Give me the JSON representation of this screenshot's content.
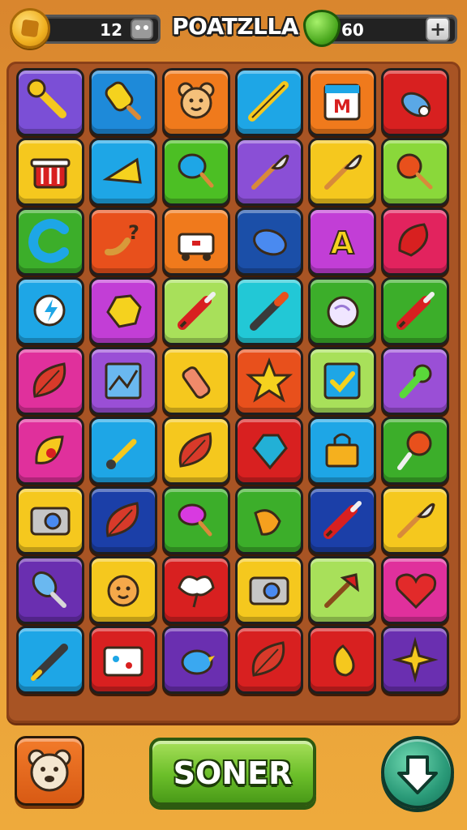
{
  "header": {
    "coins": "12",
    "title": "POATZLLA",
    "energy": "60",
    "coin_icon": "coin-icon",
    "robot_icon": "robot-icon",
    "shield_icon": "green-shield-icon",
    "plus_icon": "plus-icon"
  },
  "board": {
    "rows": 9,
    "cols": 6,
    "tiles": [
      {
        "color": "#7b4fd6",
        "icon": "wrench-icon"
      },
      {
        "color": "#1e8ad9",
        "icon": "ice-pop-icon"
      },
      {
        "color": "#f07a1c",
        "icon": "teddy-bear-icon"
      },
      {
        "color": "#1ea6e6",
        "icon": "ruler-pencil-icon"
      },
      {
        "color": "#f07a1c",
        "icon": "calendar-icon"
      },
      {
        "color": "#d82020",
        "icon": "whistle-icon"
      },
      {
        "color": "#f5c81e",
        "icon": "trash-basket-icon"
      },
      {
        "color": "#1ea6e6",
        "icon": "cheese-icon"
      },
      {
        "color": "#4cbf24",
        "icon": "balloon-icon"
      },
      {
        "color": "#8a4fd6",
        "icon": "brush-icon"
      },
      {
        "color": "#f5c81e",
        "icon": "brush-icon"
      },
      {
        "color": "#8ad83a",
        "icon": "lollipop-icon"
      },
      {
        "color": "#3cae2a",
        "icon": "letter-c-icon"
      },
      {
        "color": "#e8501c",
        "icon": "question-banana-icon"
      },
      {
        "color": "#f07a1c",
        "icon": "robot-cart-icon"
      },
      {
        "color": "#1b4fa8",
        "icon": "capsule-icon"
      },
      {
        "color": "#c23ed6",
        "icon": "letter-a-icon"
      },
      {
        "color": "#e2235e",
        "icon": "leaf-heart-icon"
      },
      {
        "color": "#1ea6e6",
        "icon": "lightning-bubble-icon"
      },
      {
        "color": "#c23ed6",
        "icon": "gold-nugget-icon"
      },
      {
        "color": "#a8e05a",
        "icon": "rocket-icon"
      },
      {
        "color": "#22c8d6",
        "icon": "marker-icon"
      },
      {
        "color": "#3cae2a",
        "icon": "moon-ball-icon"
      },
      {
        "color": "#3cae2a",
        "icon": "rocket-icon"
      },
      {
        "color": "#e0309c",
        "icon": "leaf-icon"
      },
      {
        "color": "#9a4fd6",
        "icon": "map-icon"
      },
      {
        "color": "#f5c81e",
        "icon": "bottle-icon"
      },
      {
        "color": "#e8501c",
        "icon": "star-icon"
      },
      {
        "color": "#a8e05a",
        "icon": "checkbox-icon"
      },
      {
        "color": "#9a4fd6",
        "icon": "broccoli-icon"
      },
      {
        "color": "#e0309c",
        "icon": "shell-icon"
      },
      {
        "color": "#1ea6e6",
        "icon": "paintbrush-icon"
      },
      {
        "color": "#f5c81e",
        "icon": "leaf-icon"
      },
      {
        "color": "#d82020",
        "icon": "gem-icon"
      },
      {
        "color": "#1ea6e6",
        "icon": "bag-icon"
      },
      {
        "color": "#3cae2a",
        "icon": "lollipop-face-icon"
      },
      {
        "color": "#f5c81e",
        "icon": "camera-icon"
      },
      {
        "color": "#1b3fa8",
        "icon": "leaf-icon"
      },
      {
        "color": "#3cae2a",
        "icon": "cotton-candy-icon"
      },
      {
        "color": "#3cae2a",
        "icon": "squirrel-icon"
      },
      {
        "color": "#1b3fa8",
        "icon": "rocket-icon"
      },
      {
        "color": "#f5c81e",
        "icon": "brush-icon"
      },
      {
        "color": "#6a2fb0",
        "icon": "spoon-icon"
      },
      {
        "color": "#f5c81e",
        "icon": "sun-face-icon"
      },
      {
        "color": "#d82020",
        "icon": "heart-umbrella-icon"
      },
      {
        "color": "#f5c81e",
        "icon": "camera-icon"
      },
      {
        "color": "#a8e05a",
        "icon": "axe-icon"
      },
      {
        "color": "#e0309c",
        "icon": "heart-icon"
      },
      {
        "color": "#1ea6e6",
        "icon": "pencil-icon"
      },
      {
        "color": "#d82020",
        "icon": "first-aid-kit-icon"
      },
      {
        "color": "#6a2fb0",
        "icon": "bird-icon"
      },
      {
        "color": "#d82020",
        "icon": "leaf-icon"
      },
      {
        "color": "#d82020",
        "icon": "pear-icon"
      },
      {
        "color": "#6a2fb0",
        "icon": "shuriken-icon"
      }
    ]
  },
  "footer": {
    "left_icon": "teddy-bear-icon",
    "main_label": "SONER",
    "right_icon": "down-arrow-icon"
  }
}
